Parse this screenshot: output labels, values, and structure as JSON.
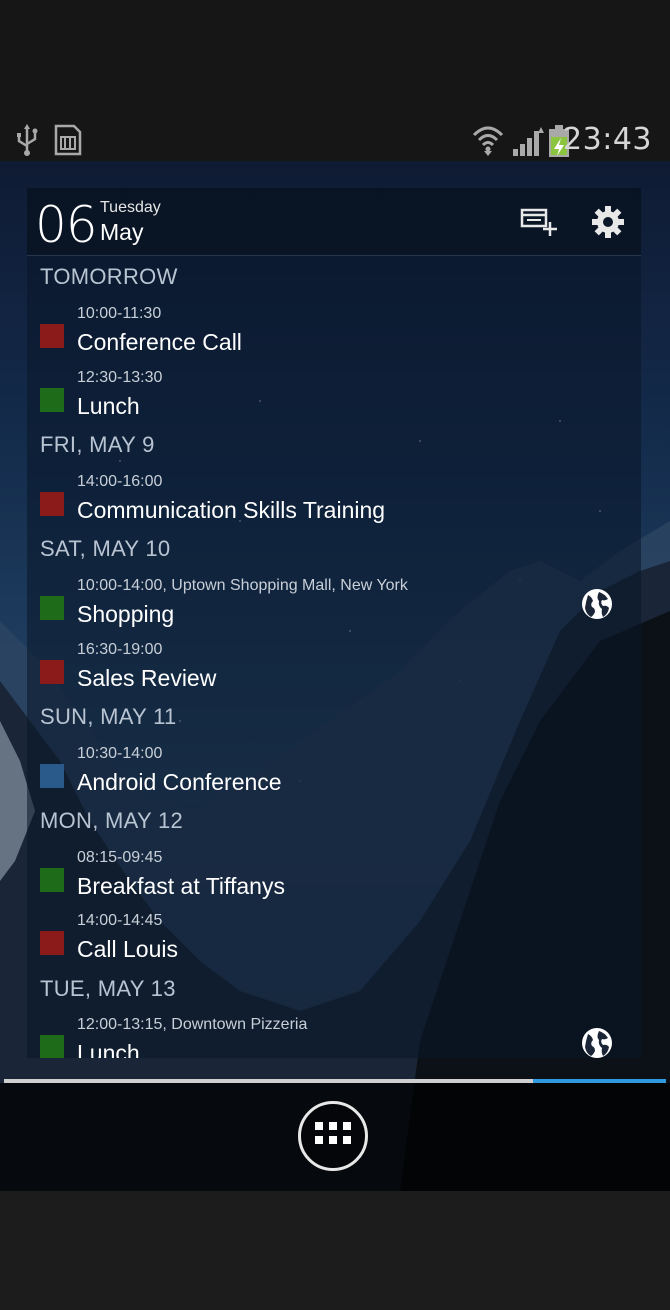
{
  "status_bar": {
    "clock": "23:43",
    "icons": [
      "usb-icon",
      "sd-card-icon",
      "wifi-icon",
      "signal-icon",
      "battery-charging-icon"
    ]
  },
  "widget": {
    "day_number": "06",
    "weekday": "Tuesday",
    "month": "May",
    "actions": [
      "add-event-icon",
      "settings-gear-icon"
    ]
  },
  "colors": {
    "red": "#8b1a1a",
    "green": "#1e6b1a",
    "blue": "#2a5a8a",
    "accent": "#2f9ae0"
  },
  "agenda": {
    "days": [
      {
        "label": "TOMORROW"
      },
      {
        "label": "FRI, MAY 9"
      },
      {
        "label": "SAT, MAY 10"
      },
      {
        "label": "SUN, MAY 11"
      },
      {
        "label": "MON, MAY 12"
      },
      {
        "label": "TUE, MAY 13"
      }
    ],
    "events": [
      {
        "time": "10:00-11:30",
        "title": "Conference Call",
        "color": "red",
        "globe": false
      },
      {
        "time": "12:30-13:30",
        "title": "Lunch",
        "color": "green",
        "globe": false
      },
      {
        "time": "14:00-16:00",
        "title": "Communication Skills Training",
        "color": "red",
        "globe": false
      },
      {
        "time": "10:00-14:00, Uptown Shopping Mall, New York",
        "title": "Shopping",
        "color": "green",
        "globe": true
      },
      {
        "time": "16:30-19:00",
        "title": "Sales Review",
        "color": "red",
        "globe": false
      },
      {
        "time": "10:30-14:00",
        "title": "Android Conference",
        "color": "blue",
        "globe": false
      },
      {
        "time": "08:15-09:45",
        "title": "Breakfast at Tiffanys",
        "color": "green",
        "globe": false
      },
      {
        "time": "14:00-14:45",
        "title": "Call Louis",
        "color": "red",
        "globe": false
      },
      {
        "time": "12:00-13:15, Downtown Pizzeria",
        "title": "Lunch",
        "color": "green",
        "globe": true
      }
    ]
  },
  "dock": {
    "apps_button": "all-apps-icon"
  }
}
